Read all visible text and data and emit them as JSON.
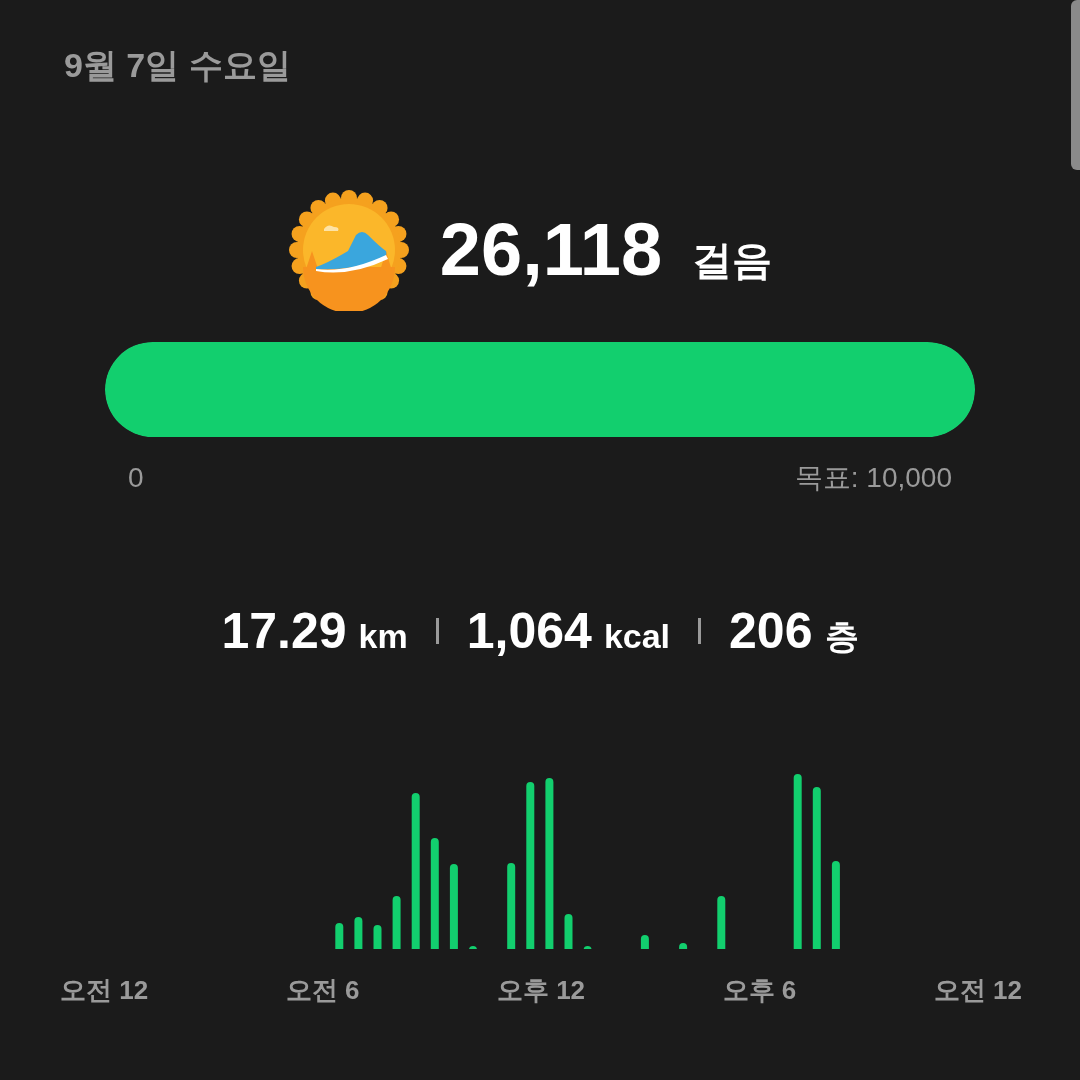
{
  "date": "9월 7일 수요일",
  "steps": {
    "count": "26,118",
    "unit": "걸음"
  },
  "goal_bar": {
    "level": 1,
    "start_label": "0",
    "goal_label": "목표: 10,000"
  },
  "stats": [
    {
      "value": "17.29",
      "unit": "km"
    },
    {
      "value": "1,064",
      "unit": "kcal"
    },
    {
      "value": "206",
      "unit": "층"
    }
  ],
  "chart": {
    "x_labels": [
      "오전 12",
      "오전 6",
      "오후 12",
      "오후 6",
      "오전 12"
    ]
  }
}
